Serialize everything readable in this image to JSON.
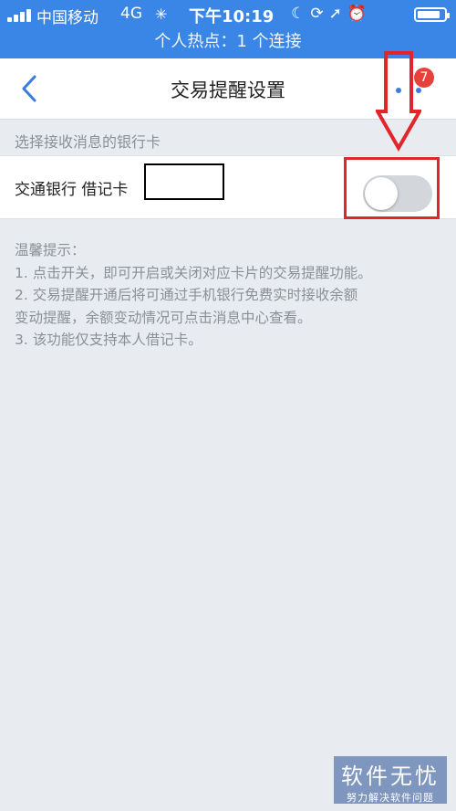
{
  "status_bar": {
    "carrier": "中国移动",
    "network": "4G",
    "time": "下午10:19",
    "icons": [
      "moon-icon",
      "rotation-lock-icon",
      "location-icon",
      "alarm-icon"
    ],
    "battery_level": 0.85
  },
  "hotspot_banner": "个人热点：1 个连接",
  "nav": {
    "title": "交易提醒设置",
    "badge_count": "7"
  },
  "section_header": "选择接收消息的银行卡",
  "card_row": {
    "label": "交通银行 借记卡",
    "toggle_on": false
  },
  "tips": {
    "title": "温馨提示：",
    "lines": [
      "1. 点击开关，即可开启或关闭对应卡片的交易提醒功能。",
      "2. 交易提醒开通后将可通过手机银行免费实时接收余额",
      "变动提醒，余额变动情况可点击消息中心查看。",
      "3. 该功能仅支持本人借记卡。"
    ]
  },
  "watermark": {
    "main": "软件无忧",
    "sub": "努力解决软件问题"
  },
  "colors": {
    "status_bar": "#3a86e6",
    "annotation_red": "#e0252c",
    "badge_red": "#e8403a",
    "accent_blue": "#3a7be0",
    "background": "#e8ebef"
  }
}
